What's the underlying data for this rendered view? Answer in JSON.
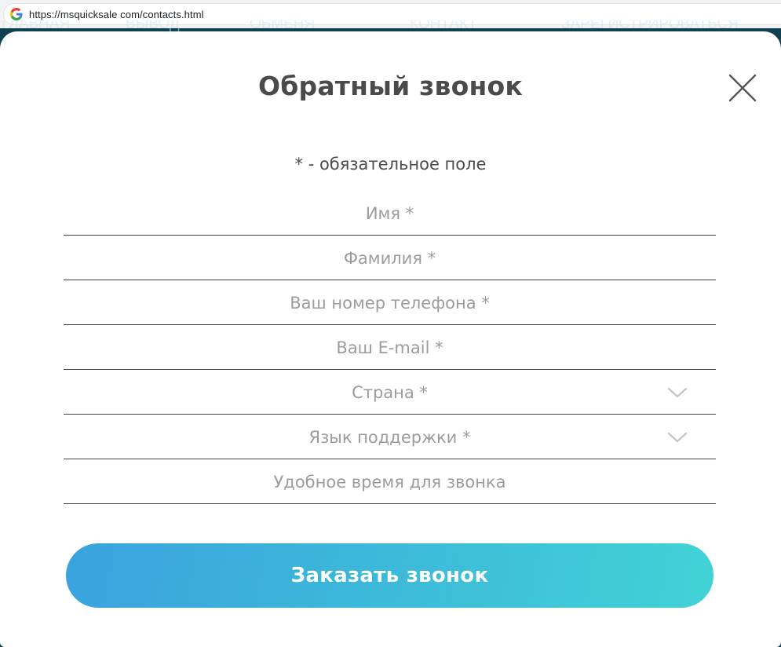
{
  "browser": {
    "url": "https://msquicksale com/contacts.html",
    "favicon_icon": "google-icon"
  },
  "background_nav": [
    "ГЛАВНАЯ",
    "ВЫВОД",
    "ОБМЕНЯ",
    "КОНТАКТ",
    "ЗАРЕГИСТРИРОВАТЬСЯ"
  ],
  "modal": {
    "title": "Обратный звонок",
    "close_icon": "close-icon",
    "required_note": "* - обязательное поле",
    "fields": {
      "first_name": {
        "value": "",
        "placeholder": "Имя *"
      },
      "last_name": {
        "value": "",
        "placeholder": "Фамилия *"
      },
      "phone": {
        "value": "",
        "placeholder": "Ваш номер телефона *"
      },
      "email": {
        "value": "",
        "placeholder": "Ваш E-mail *"
      },
      "country": {
        "label": "Страна *",
        "icon": "chevron-down-icon"
      },
      "support_language": {
        "label": "Язык поддержки *",
        "icon": "chevron-down-icon"
      },
      "call_time": {
        "value": "",
        "placeholder": "Удобное время для звонка"
      }
    },
    "submit_label": "Заказать звонок"
  },
  "colors": {
    "title": "#4a4a4a",
    "placeholder": "#9c9c9c",
    "underline": "#444444",
    "button_gradient_start": "#3aa2de",
    "button_gradient_end": "#41d3d6",
    "backdrop": "#12495b"
  }
}
